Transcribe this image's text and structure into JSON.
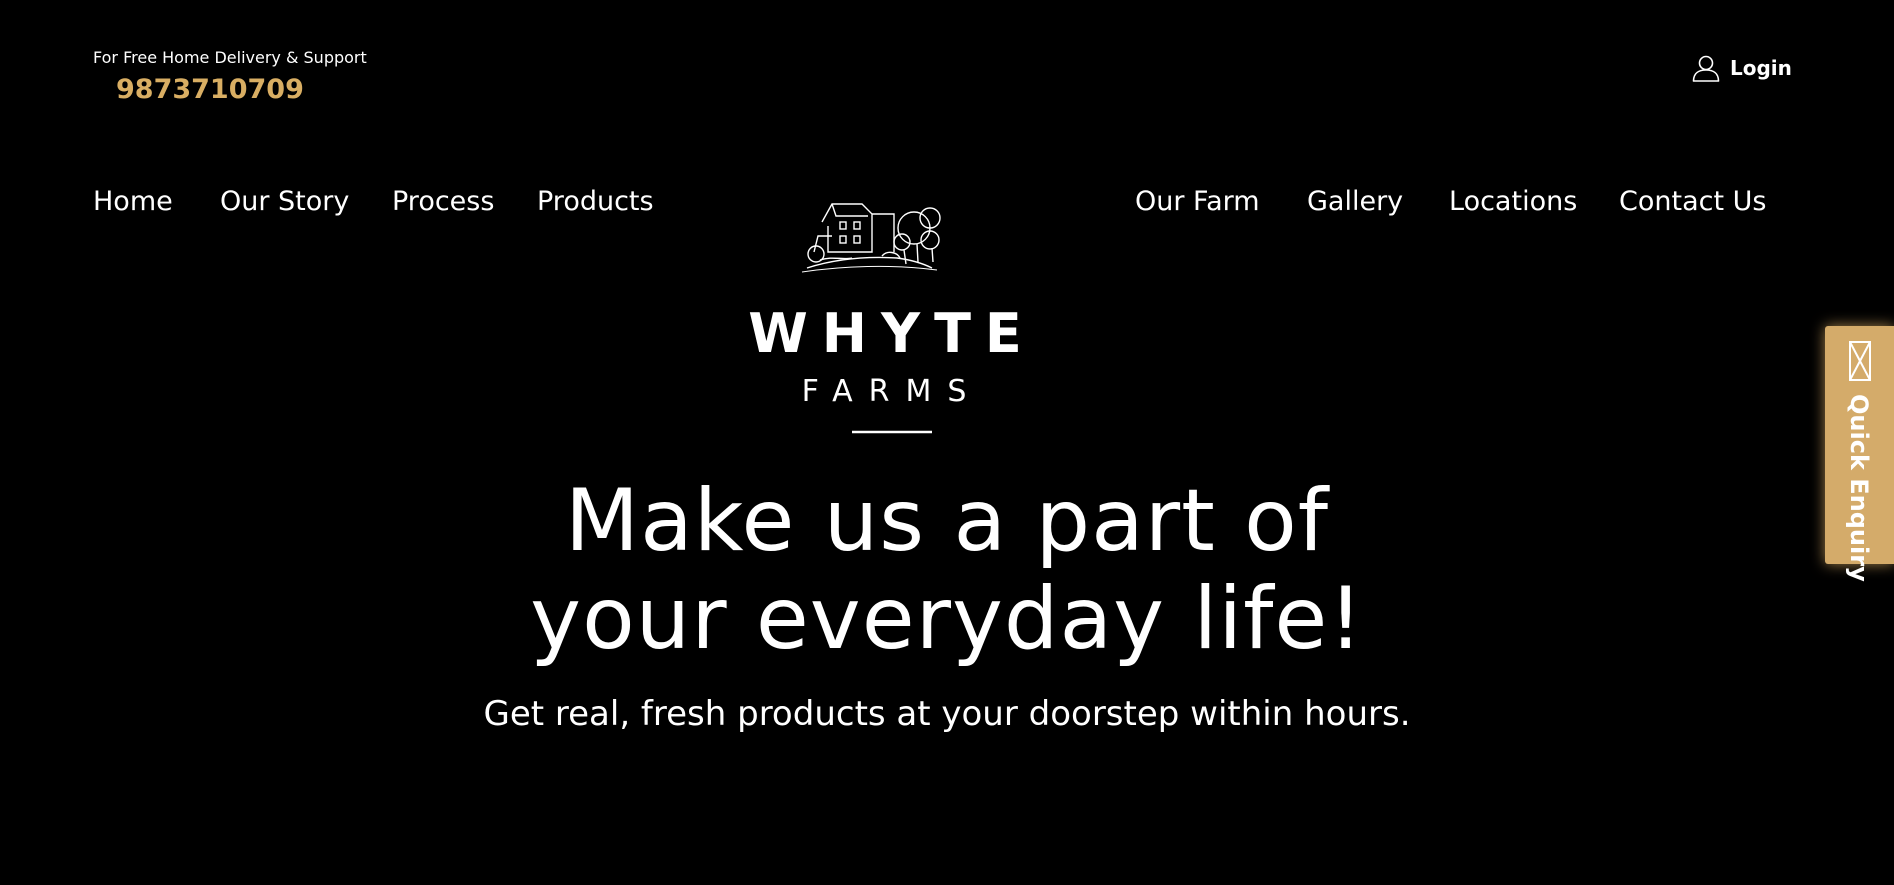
{
  "header": {
    "support_label": "For Free Home Delivery & Support",
    "phone": "9873710709",
    "login_label": "Login"
  },
  "nav": {
    "left": [
      {
        "label": "Home"
      },
      {
        "label": "Our Story"
      },
      {
        "label": "Process"
      },
      {
        "label": "Products"
      }
    ],
    "right": [
      {
        "label": "Our Farm"
      },
      {
        "label": "Gallery"
      },
      {
        "label": "Locations"
      },
      {
        "label": "Contact Us"
      }
    ]
  },
  "logo": {
    "word_top": "WHYTE",
    "word_bottom": "FARMS",
    "icon": "farmhouse-illustration"
  },
  "hero": {
    "title_line1": "Make us a part of",
    "title_line2": "your everyday life!",
    "subtitle": "Get real, fresh products at your doorstep within hours."
  },
  "enquiry": {
    "label": "Quick Enquiry",
    "icon": "mail-icon"
  },
  "colors": {
    "background": "#000000",
    "accent_gold": "#d9ae63",
    "enquiry_tab": "#d4ab6a",
    "text": "#ffffff"
  }
}
